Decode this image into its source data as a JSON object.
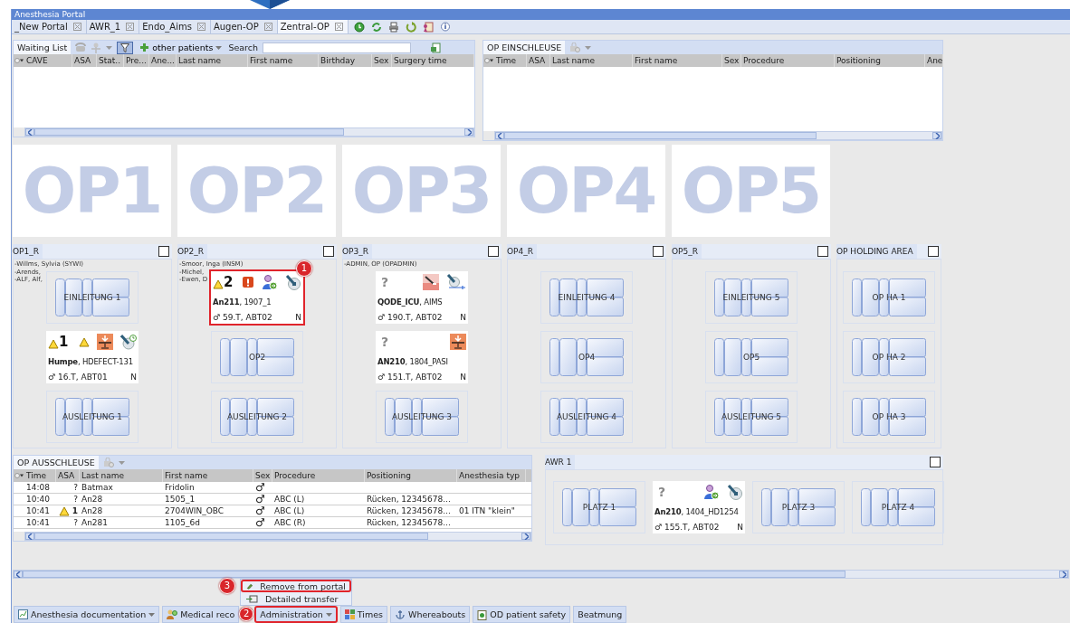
{
  "window": {
    "title": "Anesthesia Portal"
  },
  "tabs": [
    {
      "label": "_New Portal",
      "selected": false
    },
    {
      "label": "AWR_1",
      "selected": false
    },
    {
      "label": "Endo_Aims",
      "selected": false
    },
    {
      "label": "Augen-OP",
      "selected": false
    },
    {
      "label": "Zentral-OP",
      "selected": true
    }
  ],
  "waiting_list": {
    "tab": "Waiting List",
    "filter_active": true,
    "filter_label": "other patients",
    "search_label": "Search",
    "columns": [
      "CAVE",
      "ASA",
      "Stat..",
      "Pre...",
      "Ane...",
      "Last name",
      "First name",
      "Birthday",
      "Sex",
      "Surgery time"
    ]
  },
  "op_einschleuse": {
    "title": "OP EINSCHLEUSE",
    "columns": [
      "Time",
      "ASA",
      "Last name",
      "First name",
      "Sex",
      "Procedure",
      "Positioning",
      "Ane"
    ]
  },
  "op_tiles": [
    "OP1",
    "OP2",
    "OP3",
    "OP4",
    "OP5"
  ],
  "rooms": [
    {
      "title": "OP1_R",
      "checked": false,
      "staff": [
        "-Willms, Sylvia (SYWI)",
        "-Arends,",
        "-ALF, Alf,"
      ],
      "slots": [
        {
          "kind": "bed",
          "label": "EINLEITUNG 1"
        },
        {
          "kind": "patient",
          "asa": "1",
          "asa_warning": true,
          "icons": [
            {
              "kind": "caution"
            },
            {
              "kind": "transfer-table"
            },
            {
              "kind": "probe-clock"
            }
          ],
          "last_name": "Humpe",
          "case": ", HDEFECT-131",
          "sex": "♂",
          "details": "16.T, ABT01",
          "flag": "N",
          "highlighted": false
        },
        {
          "kind": "bed",
          "label": "AUSLEITUNG 1"
        }
      ]
    },
    {
      "title": "OP2_R",
      "checked": false,
      "staff": [
        "-Smoor, Inga (INSM)",
        "-Michel,",
        "-Ewen, D"
      ],
      "slots": [
        {
          "kind": "patient",
          "asa": "2",
          "asa_warning": true,
          "icons": [
            {
              "kind": "alert"
            },
            {
              "kind": "person-arrow"
            },
            {
              "kind": "probe"
            }
          ],
          "last_name": "An211",
          "case": ", 1907_1",
          "sex": "♂",
          "details": "59.T, ABT02",
          "flag": "N",
          "highlighted": true,
          "badge": "1"
        },
        {
          "kind": "bed",
          "label": "OP2"
        },
        {
          "kind": "bed",
          "label": "AUSLEITUNG 2"
        }
      ]
    },
    {
      "title": "OP3_R",
      "checked": false,
      "staff": [
        "-ADMIN, OP (OPADMIN)"
      ],
      "slots": [
        {
          "kind": "patient",
          "asa": "?",
          "asa_warning": false,
          "icons": [
            {
              "kind": "scalpel"
            },
            {
              "kind": "probe-line"
            }
          ],
          "last_name": "QODE_ICU",
          "case": ", AIMS",
          "sex": "♂",
          "details": "190.T, ABT02",
          "flag": "N",
          "highlighted": false
        },
        {
          "kind": "patient",
          "asa": "?",
          "asa_warning": false,
          "icons": [
            {
              "kind": "transfer-table"
            }
          ],
          "last_name": "AN210",
          "case": ", 1804_PASI",
          "sex": "♂",
          "details": "151.T, ABT02",
          "flag": "N",
          "highlighted": false
        },
        {
          "kind": "bed",
          "label": "AUSLEITUNG 3"
        }
      ]
    },
    {
      "title": "OP4_R",
      "checked": false,
      "slots": [
        {
          "kind": "bed",
          "label": "EINLEITUNG 4"
        },
        {
          "kind": "bed",
          "label": "OP4"
        },
        {
          "kind": "bed",
          "label": "AUSLEITUNG 4"
        }
      ]
    },
    {
      "title": "OP5_R",
      "checked": false,
      "slots": [
        {
          "kind": "bed",
          "label": "EINLEITUNG 5"
        },
        {
          "kind": "bed",
          "label": "OP5"
        },
        {
          "kind": "bed",
          "label": "AUSLEITUNG 5"
        }
      ]
    },
    {
      "title": "OP HOLDING AREA",
      "checked": false,
      "slots": [
        {
          "kind": "bed",
          "label": "OP HA 1"
        },
        {
          "kind": "bed",
          "label": "OP HA 2"
        },
        {
          "kind": "bed",
          "label": "OP HA 3"
        }
      ]
    }
  ],
  "op_ausschleuse": {
    "title": "OP AUSSCHLEUSE",
    "columns": [
      "Time",
      "ASA",
      "Last name",
      "First name",
      "Sex",
      "Procedure",
      "Positioning",
      "Anesthesia typ"
    ],
    "rows": [
      {
        "time": "14:08",
        "asa": "?",
        "asa_warning": false,
        "last_name": "Batmax",
        "first_name": "Fridolin",
        "sex": "♂"
      },
      {
        "time": "10:40",
        "asa": "?",
        "asa_warning": false,
        "last_name": "An28",
        "first_name": "1505_1",
        "sex": "♂",
        "procedure": "ABC (L)",
        "positioning": "Rücken, 12345678..."
      },
      {
        "time": "10:41",
        "asa": "1",
        "asa_warning": true,
        "last_name": "An28",
        "first_name": "2704WIN_OBC",
        "sex": "♂",
        "procedure": "ABC (L)",
        "positioning": "Rücken, 12345678...",
        "anesthesia_type": "01 ITN \"klein\""
      },
      {
        "time": "10:41",
        "asa": "?",
        "asa_warning": false,
        "last_name": "An281",
        "first_name": "1105_6d",
        "sex": "♂",
        "procedure": "ABC (R)",
        "positioning": "Rücken, 12345678..."
      }
    ]
  },
  "awr": {
    "title": "AWR 1",
    "checked": false,
    "slots": [
      {
        "kind": "bed",
        "label": "PLATZ 1"
      },
      {
        "kind": "patient",
        "asa": "?",
        "asa_warning": false,
        "icons": [
          {
            "kind": "person-arrow"
          },
          {
            "kind": "probe"
          }
        ],
        "last_name": "An210",
        "case": ", 1404_HD1254",
        "sex": "♂",
        "details": "155.T, ABT02",
        "flag": "N",
        "highlighted": false
      },
      {
        "kind": "bed",
        "label": "PLATZ 3"
      },
      {
        "kind": "bed",
        "label": "PLATZ 4"
      }
    ]
  },
  "context_menu": [
    {
      "kind": "remove",
      "label": "Remove from portal",
      "highlighted": true,
      "badge": "3"
    },
    {
      "kind": "transfer",
      "label": "Detailed transfer",
      "highlighted": false
    }
  ],
  "bottom_buttons": [
    {
      "kind": "chart",
      "label": "Anesthesia documentation",
      "dropdown": true,
      "highlighted": false
    },
    {
      "kind": "records",
      "label": "Medical reco",
      "dropdown": false,
      "highlighted": false
    },
    {
      "kind": "plain",
      "label": "Administration",
      "dropdown": true,
      "highlighted": true,
      "badge": "2"
    },
    {
      "kind": "grid",
      "label": "Times",
      "dropdown": false,
      "highlighted": false
    },
    {
      "kind": "anchor",
      "label": "Whereabouts",
      "dropdown": false,
      "highlighted": false
    },
    {
      "kind": "safety",
      "label": "OD patient safety",
      "dropdown": false,
      "highlighted": false
    },
    {
      "kind": "plain",
      "label": "Beatmung",
      "dropdown": false,
      "highlighted": false
    }
  ]
}
